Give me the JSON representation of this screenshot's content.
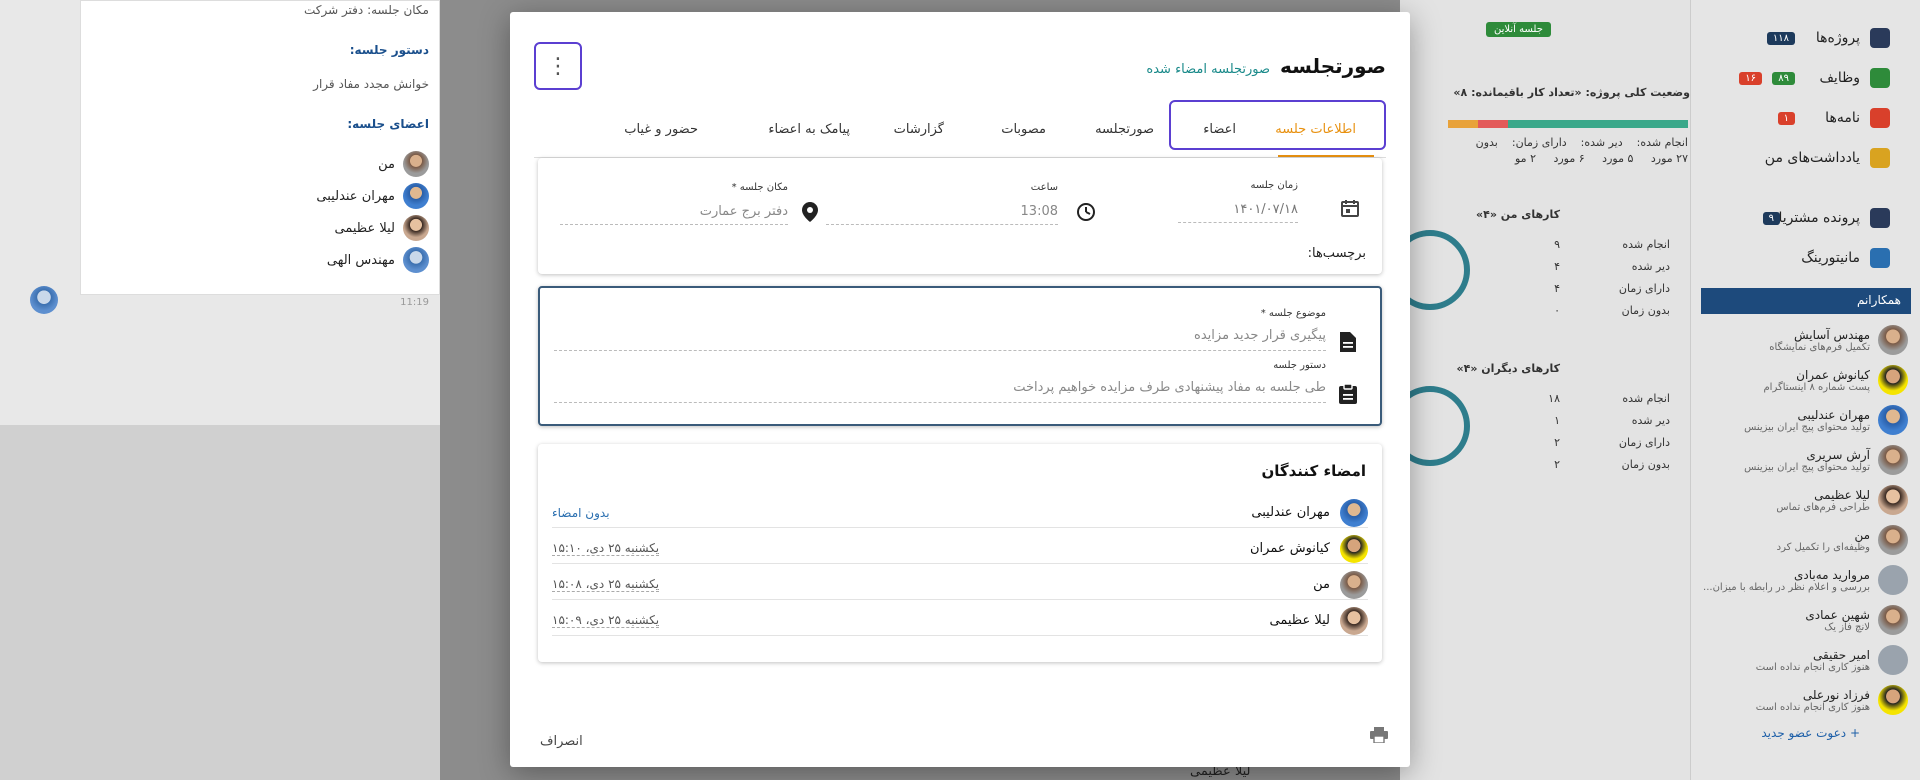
{
  "background": {
    "left_panel": {
      "location_line": "مکان جلسه: دفتر شرکت",
      "agenda_title": "دستور جلسه:",
      "agenda_text": "خوانش مجدد مفاد قرار",
      "members_title": "اعضای جلسه:",
      "members": [
        "من",
        "مهران عندلیبی",
        "لیلا عظیمی",
        "مهندس الهی"
      ],
      "time": "11:19",
      "bottom_name": "لیلا عظیمی"
    },
    "middle_panel": {
      "online_badge": "جلسه آنلاین",
      "project_status": "وضعیت کلی پروژه: «تعداد کار باقیمانده: ۸»",
      "progress_labels": [
        "۶۷٪",
        "۱۲٪",
        "۱۵٪"
      ],
      "status_row": [
        "انجام شده:",
        "دیر شده:",
        "دارای زمان:",
        "بدون"
      ],
      "status_vals": [
        "۲۷ مورد",
        "۵ مورد",
        "۶ مورد",
        "۲ مو"
      ],
      "my_tasks_title": "کارهای من «۴»",
      "my_tasks": [
        {
          "label": "انجام شده",
          "value": "۹"
        },
        {
          "label": "دیر شده",
          "value": "۴"
        },
        {
          "label": "دارای زمان",
          "value": "۴"
        },
        {
          "label": "بدون زمان",
          "value": "۰"
        }
      ],
      "others_tasks_title": "کارهای دیگران «۴»",
      "others_tasks": [
        {
          "label": "انجام شده",
          "value": "۱۸"
        },
        {
          "label": "دیر شده",
          "value": "۱"
        },
        {
          "label": "دارای زمان",
          "value": "۲"
        },
        {
          "label": "بدون زمان",
          "value": "۲"
        }
      ]
    },
    "right_sidebar": {
      "nav": [
        {
          "label": "پروژه‌ها",
          "badge": "۱۱۸"
        },
        {
          "label": "وظایف",
          "badge": "۸۹",
          "badge2": "۱۶"
        },
        {
          "label": "نامه‌ها",
          "badge": "۱"
        },
        {
          "label": "یادداشت‌های من"
        },
        {
          "label": "پرونده مشتریان",
          "badge": "۹"
        },
        {
          "label": "مانیتورینگ"
        }
      ],
      "colleagues_title": "همکارانم",
      "colleagues": [
        {
          "name": "مهندس آسایش",
          "status": "تکمیل فرم‌های نمایشگاه"
        },
        {
          "name": "کیانوش عمران",
          "status": "پست شماره ۸ اینستاگرام"
        },
        {
          "name": "مهران عندلیبی",
          "status": "تولید محتوای پیج ایران بیزینس"
        },
        {
          "name": "آرش سریری",
          "status": "تولید محتوای پیج ایران بیزینس"
        },
        {
          "name": "لیلا عظیمی",
          "status": "طراحی فرم‌های تماس"
        },
        {
          "name": "من",
          "status": "وظیفه‌ای را تکمیل کرد"
        },
        {
          "name": "مروارید مه‌بادی",
          "status": "بررسی و اعلام نظر در رابطه با میزان..."
        },
        {
          "name": "شهین عمادی",
          "status": "لانچ فاز یک"
        },
        {
          "name": "امیر حقیقی",
          "status": "هنوز کاری انجام نداده است"
        },
        {
          "name": "فرزاد نورعلی",
          "status": "هنوز کاری انجام نداده است"
        }
      ],
      "invite": "+ دعوت عضو جدید"
    }
  },
  "modal": {
    "title": "صورتجلسه",
    "subtitle": "صورتجلسه امضاء شده",
    "tabs": [
      "اطلاعات جلسه",
      "اعضاء",
      "صورتجلسه",
      "مصوبات",
      "گزارشات",
      "پیامک به اعضاء",
      "حضور و غیاب"
    ],
    "active_tab": 0,
    "meeting_info": {
      "date_label": "زمان جلسه",
      "date_value": "۱۴۰۱/۰۷/۱۸",
      "time_label": "ساعت",
      "time_value": "13:08",
      "location_label": "مکان جلسه *",
      "location_value": "دفتر برج عمارت",
      "tags_label": "برچسب‌ها:"
    },
    "subject": {
      "subject_label": "موضوع جلسه *",
      "subject_value": "پیگیری قرار جدید مزایده",
      "agenda_label": "دستور جلسه",
      "agenda_value": "طی جلسه به مفاد پیشنهادی طرف مزایده خواهیم پرداخت"
    },
    "signers": {
      "title": "امضاء کنندگان",
      "rows": [
        {
          "name": "مهران عندلیبی",
          "status": "بدون امضاء"
        },
        {
          "name": "کیانوش عمران",
          "status": "یکشنبه ۲۵ دی،  ۱۵:۱۰"
        },
        {
          "name": "من",
          "status": "یکشنبه ۲۵ دی،  ۱۵:۰۸"
        },
        {
          "name": "لیلا عظیمی",
          "status": "یکشنبه ۲۵ دی،  ۱۵:۰۹"
        }
      ]
    },
    "footer": {
      "cancel": "انصراف"
    }
  },
  "colors": {
    "accent_tab": "#e89110",
    "highlight": "#5b3fd1",
    "subtitle": "#1a8a8a",
    "sidebar_header": "#1d4a7c"
  }
}
